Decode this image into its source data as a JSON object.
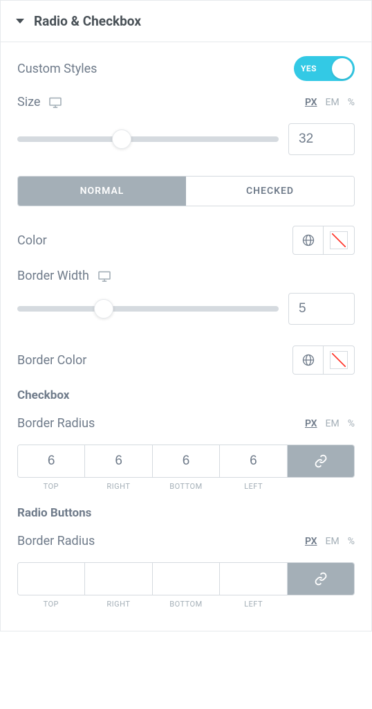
{
  "header": {
    "title": "Radio & Checkbox"
  },
  "custom_styles": {
    "label": "Custom Styles",
    "toggle_text": "YES"
  },
  "size": {
    "label": "Size",
    "units": {
      "px": "PX",
      "em": "EM",
      "pct": "%"
    },
    "value": "32",
    "thumb_pct": 40
  },
  "tabs": {
    "normal": "NORMAL",
    "checked": "CHECKED"
  },
  "color": {
    "label": "Color"
  },
  "border_width": {
    "label": "Border Width",
    "value": "5",
    "thumb_pct": 33
  },
  "border_color": {
    "label": "Border Color"
  },
  "checkbox": {
    "title": "Checkbox",
    "border_radius_label": "Border Radius",
    "units": {
      "px": "PX",
      "em": "EM",
      "pct": "%"
    },
    "values": {
      "top": "6",
      "right": "6",
      "bottom": "6",
      "left": "6"
    },
    "sides": {
      "top": "TOP",
      "right": "RIGHT",
      "bottom": "BOTTOM",
      "left": "LEFT"
    }
  },
  "radio": {
    "title": "Radio Buttons",
    "border_radius_label": "Border Radius",
    "units": {
      "px": "PX",
      "em": "EM",
      "pct": "%"
    },
    "values": {
      "top": "",
      "right": "",
      "bottom": "",
      "left": ""
    },
    "sides": {
      "top": "TOP",
      "right": "RIGHT",
      "bottom": "BOTTOM",
      "left": "LEFT"
    }
  }
}
